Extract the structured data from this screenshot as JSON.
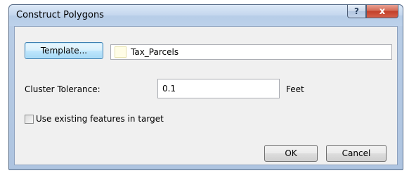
{
  "window": {
    "title": "Construct Polygons",
    "help_glyph": "?",
    "close_glyph": "x"
  },
  "template": {
    "button_label": "Template...",
    "layer_name": "Tax_Parcels",
    "swatch_color": "#fffde6"
  },
  "tolerance": {
    "label": "Cluster Tolerance:",
    "value": "0.1",
    "unit": "Feet"
  },
  "options": {
    "use_existing_label": "Use existing features in target",
    "use_existing_checked": false
  },
  "footer": {
    "ok_label": "OK",
    "cancel_label": "Cancel"
  }
}
